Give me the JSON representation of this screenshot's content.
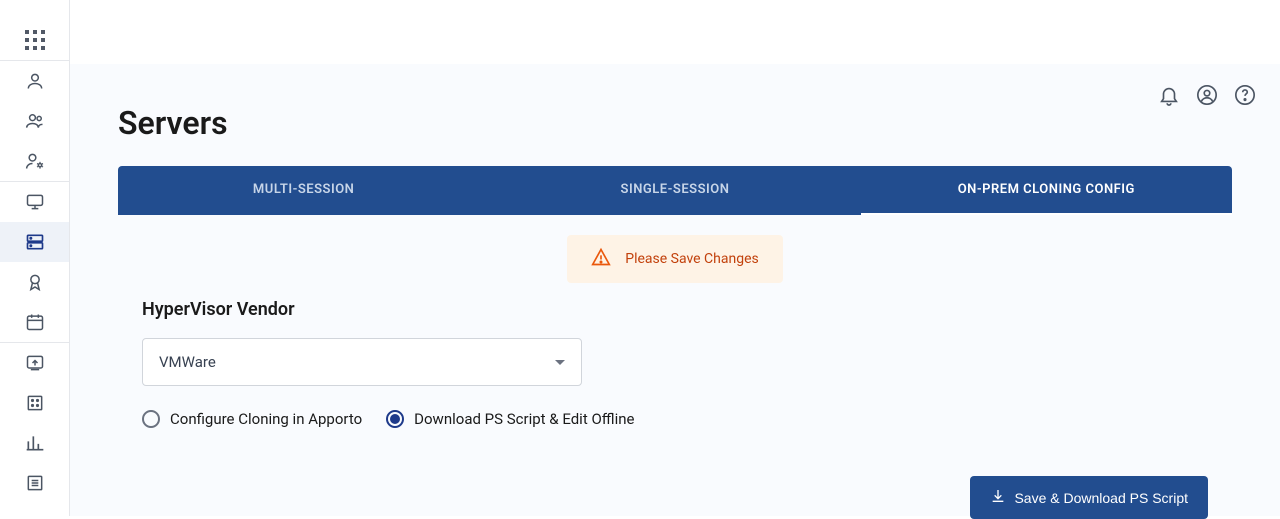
{
  "page": {
    "title": "Servers"
  },
  "tabs": [
    {
      "label": "MULTI-SESSION",
      "active": false
    },
    {
      "label": "SINGLE-SESSION",
      "active": false
    },
    {
      "label": "ON-PREM CLONING CONFIG",
      "active": true
    }
  ],
  "alert": {
    "message": "Please Save Changes"
  },
  "form": {
    "hypervisor_label": "HyperVisor Vendor",
    "vendor_selected": "VMWare",
    "radios": {
      "configure": {
        "label": "Configure Cloning in Apporto",
        "checked": false
      },
      "download": {
        "label": "Download PS Script & Edit Offline",
        "checked": true
      }
    }
  },
  "buttons": {
    "save": "Save & Download PS Script"
  }
}
